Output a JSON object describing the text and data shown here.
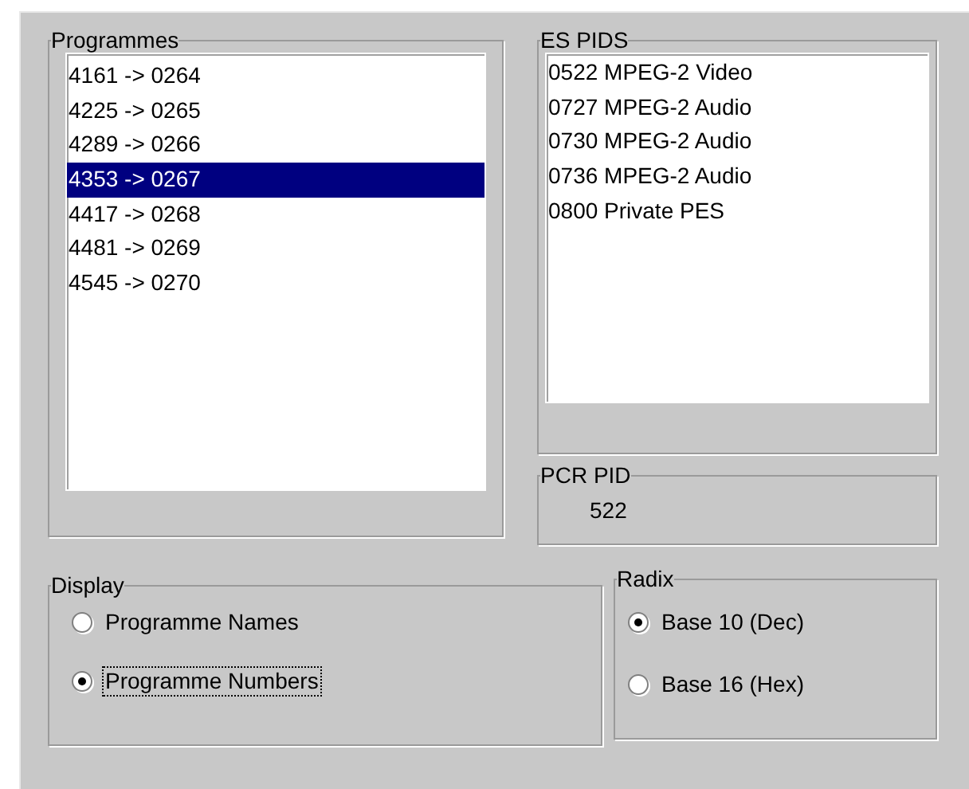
{
  "programmes": {
    "label": "Programmes",
    "items": [
      {
        "text": "4161 -> 0264",
        "selected": false
      },
      {
        "text": "4225 -> 0265",
        "selected": false
      },
      {
        "text": "4289 -> 0266",
        "selected": false
      },
      {
        "text": "4353 -> 0267",
        "selected": true
      },
      {
        "text": "4417 -> 0268",
        "selected": false
      },
      {
        "text": "4481 -> 0269",
        "selected": false
      },
      {
        "text": "4545 -> 0270",
        "selected": false
      }
    ]
  },
  "es_pids": {
    "label": "ES PIDS",
    "items": [
      "0522 MPEG-2 Video",
      "0727 MPEG-2 Audio",
      "0730 MPEG-2 Audio",
      "0736 MPEG-2 Audio",
      "0800 Private PES"
    ]
  },
  "pcr_pid": {
    "label": "PCR PID",
    "value": "522"
  },
  "display": {
    "label": "Display",
    "options": [
      {
        "label": "Programme Names",
        "selected": false,
        "focused": false
      },
      {
        "label": "Programme Numbers",
        "selected": true,
        "focused": true
      }
    ]
  },
  "radix": {
    "label": "Radix",
    "options": [
      {
        "label": "Base 10 (Dec)",
        "selected": true,
        "focused": false
      },
      {
        "label": "Base 16 (Hex)",
        "selected": false,
        "focused": false
      }
    ]
  }
}
